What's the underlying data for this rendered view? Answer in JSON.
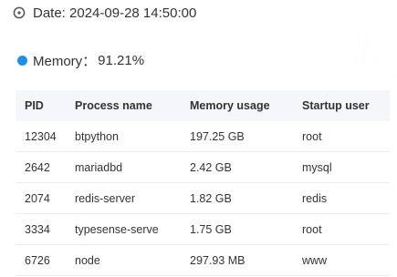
{
  "header": {
    "date_label": "Date: 2024-09-28 14:50:00",
    "icon": "clock-icon"
  },
  "tooltip": {
    "series_color": "#1e90ea",
    "series_label": "Memory：",
    "series_value": "91.21%",
    "columns": [
      "PID",
      "Process name",
      "Memory usage",
      "Startup user"
    ],
    "rows": [
      {
        "pid": "12304",
        "name": "btpython",
        "memory": "197.25 GB",
        "user": "root"
      },
      {
        "pid": "2642",
        "name": "mariadbd",
        "memory": "2.42 GB",
        "user": "mysql"
      },
      {
        "pid": "2074",
        "name": "redis-server",
        "memory": "1.82 GB",
        "user": "redis"
      },
      {
        "pid": "3334",
        "name": "typesense-serve",
        "memory": "1.75 GB",
        "user": "root"
      },
      {
        "pid": "6726",
        "name": "node",
        "memory": "297.93 MB",
        "user": "www"
      }
    ]
  }
}
